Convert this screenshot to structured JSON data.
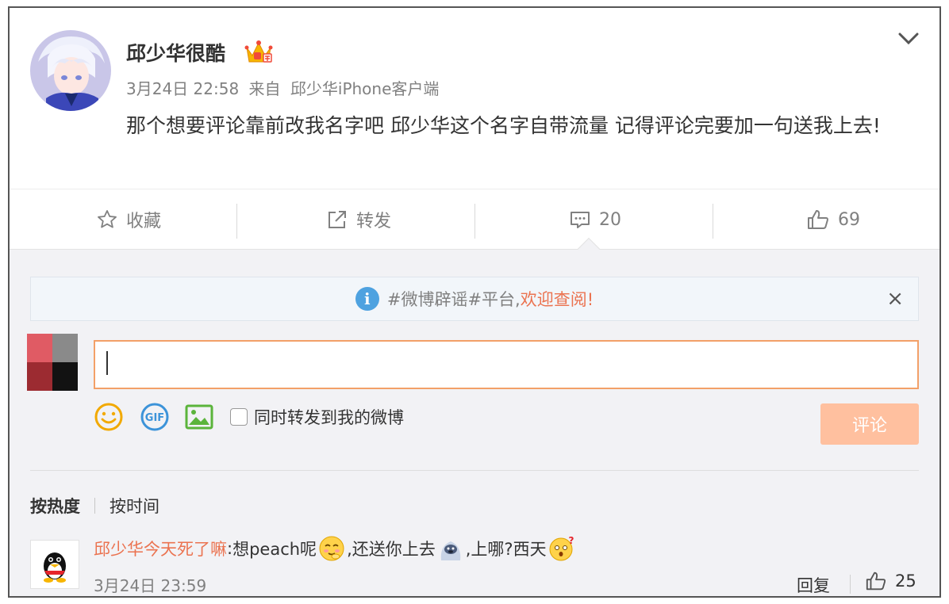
{
  "post": {
    "username": "邱少华很酷",
    "date": "3月24日 22:58",
    "from_label": "来自",
    "source": "邱少华iPhone客户端",
    "text": "那个想要评论靠前改我名字吧 邱少华这个名字自带流量 记得评论完要加一句送我上去!"
  },
  "actions": {
    "favorite_label": "收藏",
    "repost_label": "转发",
    "comment_count": "20",
    "like_count": "69"
  },
  "notice": {
    "tag_text": "#微博辟谣#平台,",
    "link_text": "欢迎查阅!",
    "close_symbol": "×"
  },
  "composer": {
    "input_value": "",
    "also_repost_label": "同时转发到我的微博",
    "submit_label": "评论",
    "icons": [
      "smiley-icon",
      "gif-icon",
      "image-icon"
    ]
  },
  "sort": {
    "by_hot": "按热度",
    "by_time": "按时间"
  },
  "comments": [
    {
      "user": "邱少华今天死了嘛",
      "colon": ":",
      "text_1": "想peach呢",
      "text_2": ",还送你上去",
      "text_3": ",上哪?西天",
      "time": "3月24日 23:59",
      "reply_label": "回复",
      "likes": "25"
    }
  ],
  "colors": {
    "accent_orange": "#eb7350",
    "submit_bg": "#ffc09f",
    "input_border": "#f3a068",
    "info_blue": "#4ea2e0",
    "muted_text": "#808080"
  }
}
